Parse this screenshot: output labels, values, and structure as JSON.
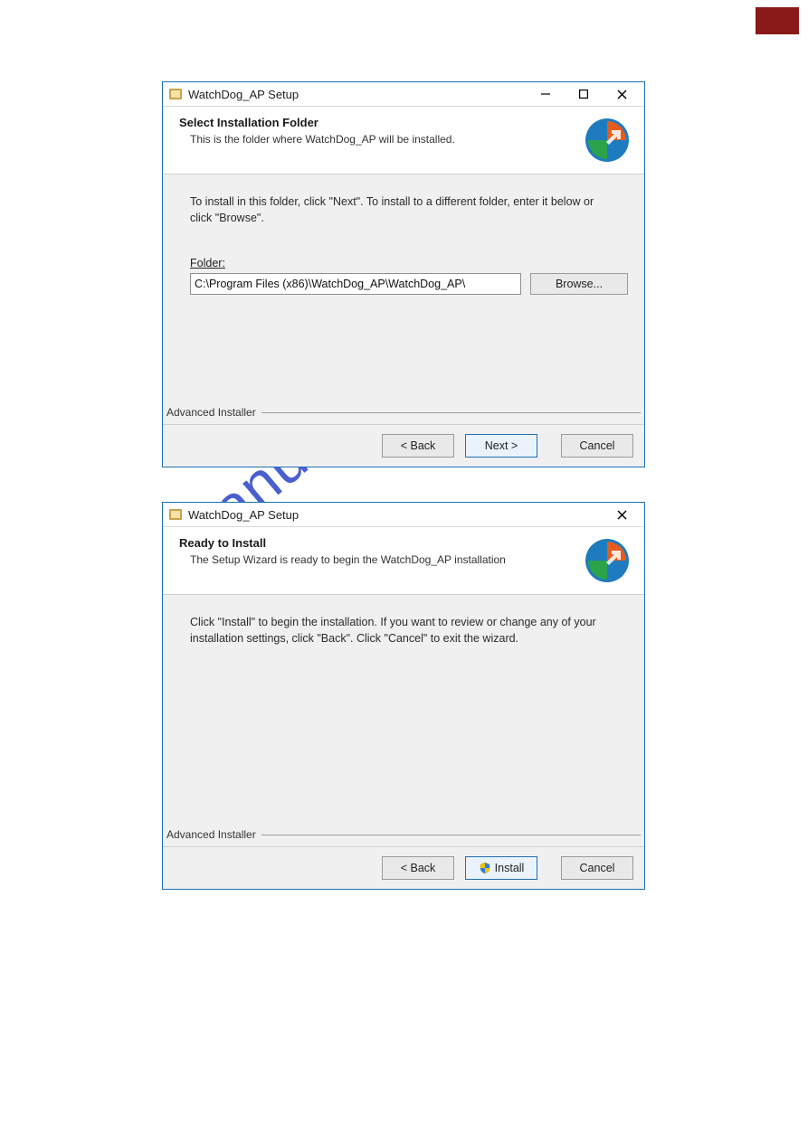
{
  "watermark": "manualshive.com",
  "dialog1": {
    "title": "WatchDog_AP Setup",
    "headerTitle": "Select Installation Folder",
    "headerSub": "This is the folder where WatchDog_AP will be installed.",
    "bodyText": "To install in this folder, click \"Next\". To install to a different folder, enter it below or click \"Browse\".",
    "folderLabel": "Folder:",
    "folderValue": "C:\\Program Files (x86)\\WatchDog_AP\\WatchDog_AP\\",
    "browse": "Browse...",
    "brand": "Advanced Installer",
    "back": "< Back",
    "next": "Next >",
    "cancel": "Cancel"
  },
  "dialog2": {
    "title": "WatchDog_AP Setup",
    "headerTitle": "Ready to Install",
    "headerSub": "The Setup Wizard is ready to begin the WatchDog_AP installation",
    "bodyText": "Click \"Install\" to begin the installation.  If you want to review or change any of your installation settings, click \"Back\".  Click \"Cancel\" to exit the wizard.",
    "brand": "Advanced Installer",
    "back": "< Back",
    "install": "Install",
    "cancel": "Cancel"
  }
}
